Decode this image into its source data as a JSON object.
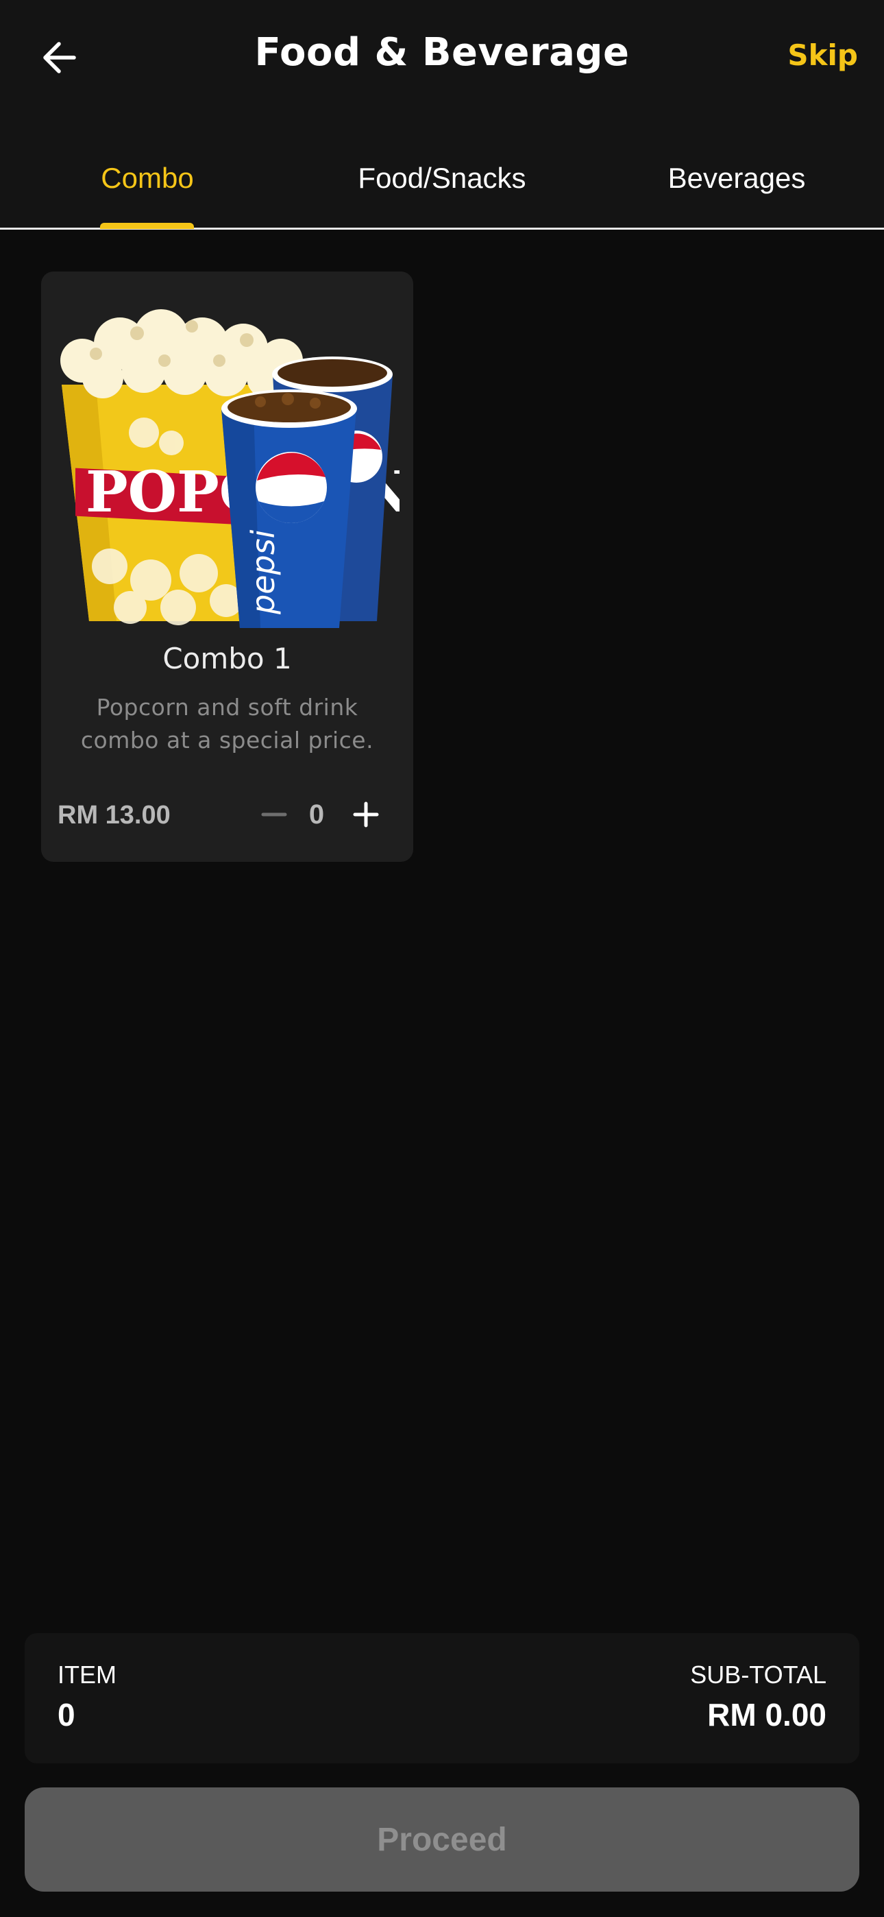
{
  "header": {
    "title": "Food & Beverage",
    "skip_label": "Skip",
    "back_icon": "arrow-left-icon"
  },
  "tabs": [
    {
      "label": "Combo",
      "active": true
    },
    {
      "label": "Food/Snacks",
      "active": false
    },
    {
      "label": "Beverages",
      "active": false
    }
  ],
  "products": [
    {
      "title": "Combo 1",
      "description": "Popcorn and soft drink combo at a special price.",
      "price": "RM 13.00",
      "quantity": "0",
      "image_text": {
        "popcorn": "POPCORN",
        "drink": "pepsi"
      }
    }
  ],
  "summary": {
    "item_label": "ITEM",
    "item_value": "0",
    "subtotal_label": "SUB-TOTAL",
    "subtotal_value": "RM 0.00"
  },
  "proceed_label": "Proceed",
  "colors": {
    "accent": "#f5c518",
    "background": "#0c0c0c",
    "card": "#1f1f1f",
    "button_disabled": "#5a5a5a"
  }
}
